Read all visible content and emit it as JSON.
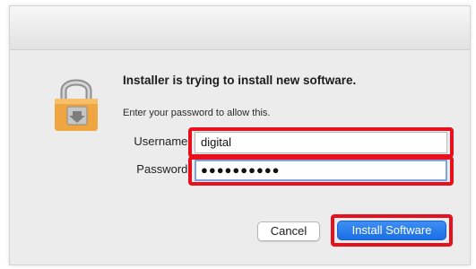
{
  "dialog": {
    "title": "Installer is trying to install new software.",
    "subtitle": "Enter your password to allow this.",
    "username_label": "Username:",
    "username_value": "digital",
    "password_label": "Password:",
    "password_value": "●●●●●●●●●●",
    "cancel_label": "Cancel",
    "install_label": "Install Software",
    "icon": "lock-icon"
  },
  "colors": {
    "highlight": "#e8101d",
    "primary_button": "#1a6fe6",
    "lock_body": "#f0a640"
  }
}
